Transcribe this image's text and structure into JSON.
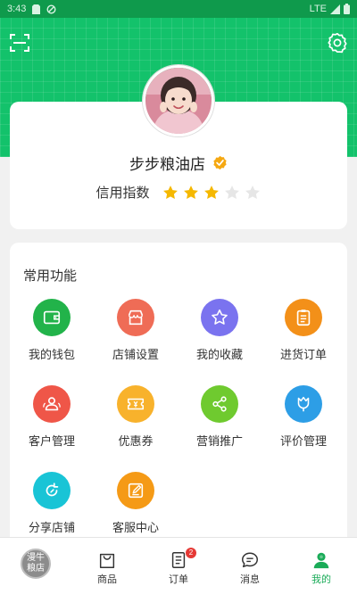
{
  "status_bar": {
    "time": "3:43",
    "network": "LTE"
  },
  "profile": {
    "shop_name": "步步粮油店",
    "credit_label": "信用指数",
    "credit_rating": 3,
    "credit_max": 5
  },
  "functions": {
    "title": "常用功能",
    "items": [
      {
        "label": "我的钱包",
        "icon": "wallet-icon",
        "color": "#22b34a"
      },
      {
        "label": "店铺设置",
        "icon": "store-icon",
        "color": "#ef6c56"
      },
      {
        "label": "我的收藏",
        "icon": "star-icon",
        "color": "#7a73ef"
      },
      {
        "label": "进货订单",
        "icon": "clipboard-icon",
        "color": "#f39019"
      },
      {
        "label": "客户管理",
        "icon": "users-icon",
        "color": "#ef5648"
      },
      {
        "label": "优惠券",
        "icon": "coupon-icon",
        "color": "#f8b22c"
      },
      {
        "label": "营销推广",
        "icon": "share-icon",
        "color": "#6fca2f"
      },
      {
        "label": "评价管理",
        "icon": "flower-icon",
        "color": "#2d9ee6"
      },
      {
        "label": "分享店铺",
        "icon": "refresh-share-icon",
        "color": "#19c4d6"
      },
      {
        "label": "客服中心",
        "icon": "edit-icon",
        "color": "#f59a16"
      }
    ]
  },
  "tabbar": {
    "logo_text": "漫牛粮店",
    "tabs": [
      {
        "label": "商品",
        "icon": "bag-icon"
      },
      {
        "label": "订单",
        "icon": "order-icon",
        "badge": "2"
      },
      {
        "label": "消息",
        "icon": "message-icon"
      },
      {
        "label": "我的",
        "icon": "person-icon",
        "active": true
      }
    ]
  },
  "colors": {
    "header_green": "#13c26b",
    "accent_green": "#1aab58",
    "star_gold": "#f5b800",
    "star_empty": "#e6e6e6"
  }
}
